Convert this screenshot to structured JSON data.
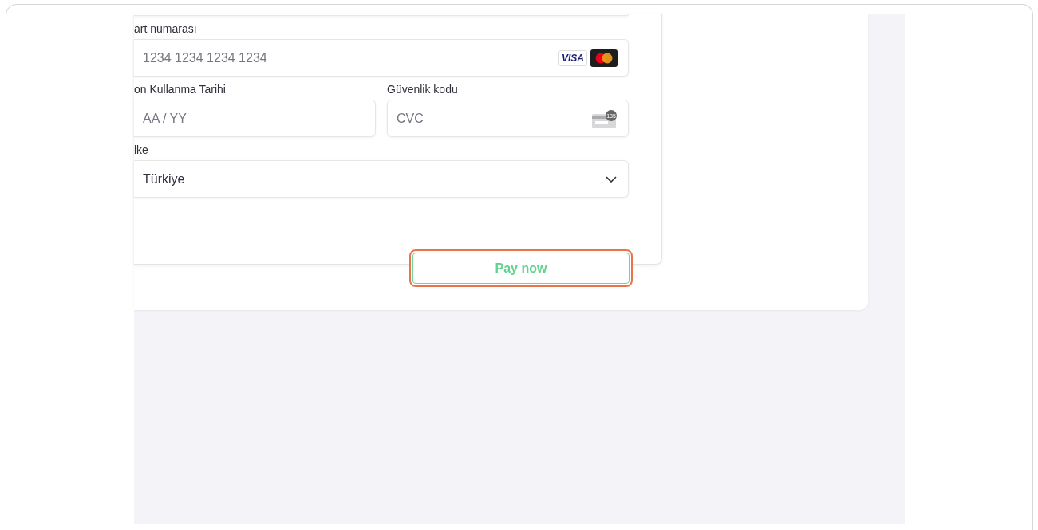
{
  "card_number": {
    "label": "art numarası",
    "placeholder": "1234 1234 1234 1234",
    "visa_badge": "VISA"
  },
  "expiry": {
    "label": "on Kullanma Tarihi",
    "placeholder": "AA / YY"
  },
  "security_code": {
    "label": "Güvenlik kodu",
    "placeholder": "CVC",
    "icon_digits": "135"
  },
  "country": {
    "label": "lke",
    "value": "Türkiye"
  },
  "pay_button": {
    "label": "Pay now",
    "focused": true
  }
}
